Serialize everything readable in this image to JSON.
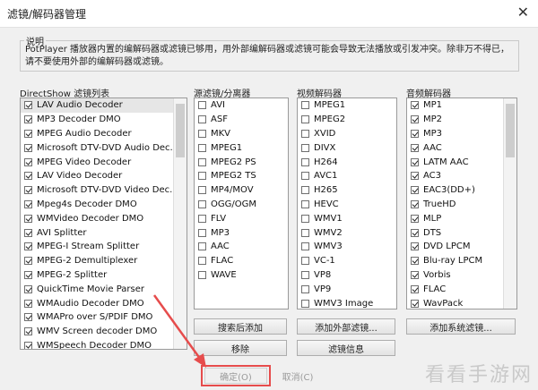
{
  "window": {
    "title": "滤镜/解码器管理"
  },
  "description": {
    "label": "说明",
    "text": "PotPlayer 播放器内置的编解码器或滤镜已够用，用外部编解码器或滤镜可能会导致无法播放或引发冲突。除非万不得已，请不要使用外部的编解码器或滤镜。"
  },
  "directshow": {
    "label": "DirectShow 滤镜列表",
    "items": [
      {
        "name": "LAV Audio Decoder",
        "checked": true,
        "selected": true
      },
      {
        "name": "MP3 Decoder DMO",
        "checked": true
      },
      {
        "name": "MPEG Audio Decoder",
        "checked": true
      },
      {
        "name": "Microsoft DTV-DVD Audio Dec...",
        "checked": true
      },
      {
        "name": "MPEG Video Decoder",
        "checked": true
      },
      {
        "name": "LAV Video Decoder",
        "checked": true
      },
      {
        "name": "Microsoft DTV-DVD Video Dec...",
        "checked": true
      },
      {
        "name": "Mpeg4s Decoder DMO",
        "checked": true
      },
      {
        "name": "WMVideo Decoder DMO",
        "checked": true
      },
      {
        "name": "AVI Splitter",
        "checked": true
      },
      {
        "name": "MPEG-I Stream Splitter",
        "checked": true
      },
      {
        "name": "MPEG-2 Demultiplexer",
        "checked": true
      },
      {
        "name": "MPEG-2 Splitter",
        "checked": true
      },
      {
        "name": "QuickTime Movie Parser",
        "checked": true
      },
      {
        "name": "WMAudio Decoder DMO",
        "checked": true
      },
      {
        "name": "WMAPro over S/PDIF DMO",
        "checked": true
      },
      {
        "name": "WMV Screen decoder DMO",
        "checked": true
      },
      {
        "name": "WMSpeech Decoder DMO",
        "checked": true
      }
    ]
  },
  "source": {
    "label": "源滤镜/分离器",
    "items": [
      "AVI",
      "ASF",
      "MKV",
      "MPEG1",
      "MPEG2 PS",
      "MPEG2 TS",
      "MP4/MOV",
      "OGG/OGM",
      "FLV",
      "MP3",
      "AAC",
      "FLAC",
      "WAVE"
    ],
    "buttons": {
      "search": "搜索后添加",
      "remove": "移除"
    }
  },
  "video": {
    "label": "视频解码器",
    "items": [
      "MPEG1",
      "MPEG2",
      "XVID",
      "DIVX",
      "H264",
      "AVC1",
      "H265",
      "HEVC",
      "WMV1",
      "WMV2",
      "WMV3",
      "VC-1",
      "VP8",
      "VP9",
      "WMV3 Image"
    ],
    "buttons": {
      "add_external": "添加外部滤镜...",
      "filter_info": "滤镜信息"
    }
  },
  "audio": {
    "label": "音频解码器",
    "items": [
      "MP1",
      "MP2",
      "MP3",
      "AAC",
      "LATM AAC",
      "AC3",
      "EAC3(DD+)",
      "TrueHD",
      "MLP",
      "DTS",
      "DVD LPCM",
      "Blu-ray LPCM",
      "Vorbis",
      "FLAC",
      "WavPack"
    ],
    "buttons": {
      "add_system": "添加系统滤镜..."
    }
  },
  "footer": {
    "ok": "确定(O)",
    "cancel": "取消(C)"
  },
  "watermark": "看看手游网",
  "colors": {
    "highlight": "#e64c4c"
  }
}
